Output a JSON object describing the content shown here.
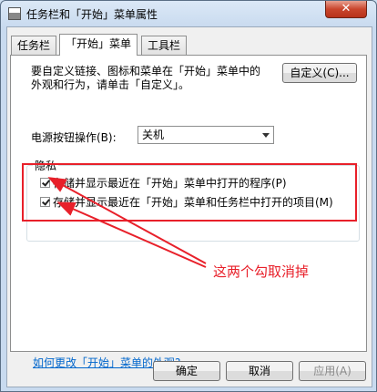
{
  "window": {
    "title": "任务栏和「开始」菜单属性",
    "close_glyph": "✕"
  },
  "tabs": [
    {
      "label": "任务栏"
    },
    {
      "label": "「开始」菜单"
    },
    {
      "label": "工具栏"
    }
  ],
  "start_menu": {
    "description": "要自定义链接、图标和菜单在「开始」菜单中的外观和行为，请单击「自定义」。",
    "customize_label": "自定义(C)...",
    "power_label": "电源按钮操作(B):",
    "power_value": "关机",
    "privacy": {
      "title": "隐私",
      "option1": "存储并显示最近在「开始」菜单中打开的程序(P)",
      "option2": "存储并显示最近在「开始」菜单和任务栏中打开的项目(M)"
    },
    "annotation": "这两个勾取消掉",
    "help_link": "如何更改「开始」菜单的外观?"
  },
  "footer": {
    "ok": "确定",
    "cancel": "取消",
    "apply": "应用(A)"
  },
  "colors": {
    "annotation_red": "#e8202a",
    "link_blue": "#0066cc"
  }
}
